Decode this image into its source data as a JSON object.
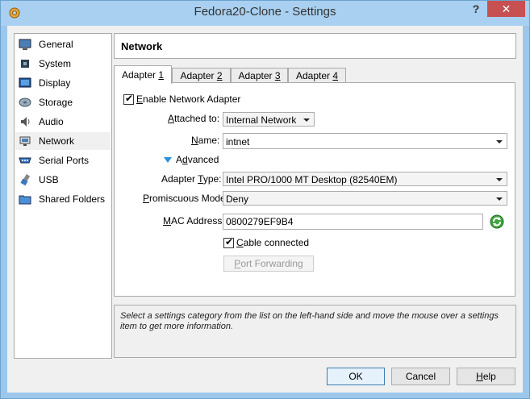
{
  "window": {
    "title": "Fedora20-Clone - Settings",
    "help_glyph": "?",
    "close_glyph": "✕"
  },
  "sidebar": {
    "items": [
      {
        "label": "General",
        "icon": "monitor-icon"
      },
      {
        "label": "System",
        "icon": "chip-icon"
      },
      {
        "label": "Display",
        "icon": "display-icon"
      },
      {
        "label": "Storage",
        "icon": "disk-icon"
      },
      {
        "label": "Audio",
        "icon": "speaker-icon"
      },
      {
        "label": "Network",
        "icon": "network-icon"
      },
      {
        "label": "Serial Ports",
        "icon": "serial-port-icon"
      },
      {
        "label": "USB",
        "icon": "usb-icon"
      },
      {
        "label": "Shared Folders",
        "icon": "folder-icon"
      }
    ],
    "selected": "Network"
  },
  "page": {
    "title": "Network"
  },
  "tabs": [
    {
      "label": "Adapter ",
      "num": "1"
    },
    {
      "label": "Adapter ",
      "num": "2"
    },
    {
      "label": "Adapter ",
      "num": "3"
    },
    {
      "label": "Adapter ",
      "num": "4"
    }
  ],
  "adapter": {
    "enable_pre": "",
    "enable_ul": "E",
    "enable_post": "nable Network Adapter",
    "attached_label_ul": "A",
    "attached_label_rest": "ttached to:",
    "attached_value": "Internal Network",
    "name_label_ul": "N",
    "name_label_rest": "ame:",
    "name_value": "intnet",
    "advanced_pre": "A",
    "advanced_ul": "d",
    "advanced_post": "vanced",
    "type_label_pre": "Adapter ",
    "type_label_ul": "T",
    "type_label_post": "ype:",
    "type_value": "Intel PRO/1000 MT Desktop (82540EM)",
    "promisc_label_ul": "P",
    "promisc_label_rest": "romiscuous Mode:",
    "promisc_value": "Deny",
    "mac_label_pre": "",
    "mac_label_ul": "M",
    "mac_label_post": "AC Address:",
    "mac_value": "0800279EF9B4",
    "cable_ul": "C",
    "cable_rest": "able connected",
    "port_forwarding_pre": "",
    "port_forwarding_ul": "P",
    "port_forwarding_post": "ort Forwarding"
  },
  "info": {
    "text": "Select a settings category from the list on the left-hand side and move the mouse over a settings item to get more information."
  },
  "buttons": {
    "ok": "OK",
    "cancel": "Cancel",
    "help_ul": "H",
    "help_rest": "elp"
  },
  "colors": {
    "titlebar": "#a9d0f0",
    "close": "#c75050",
    "accent": "#2a90d8"
  }
}
